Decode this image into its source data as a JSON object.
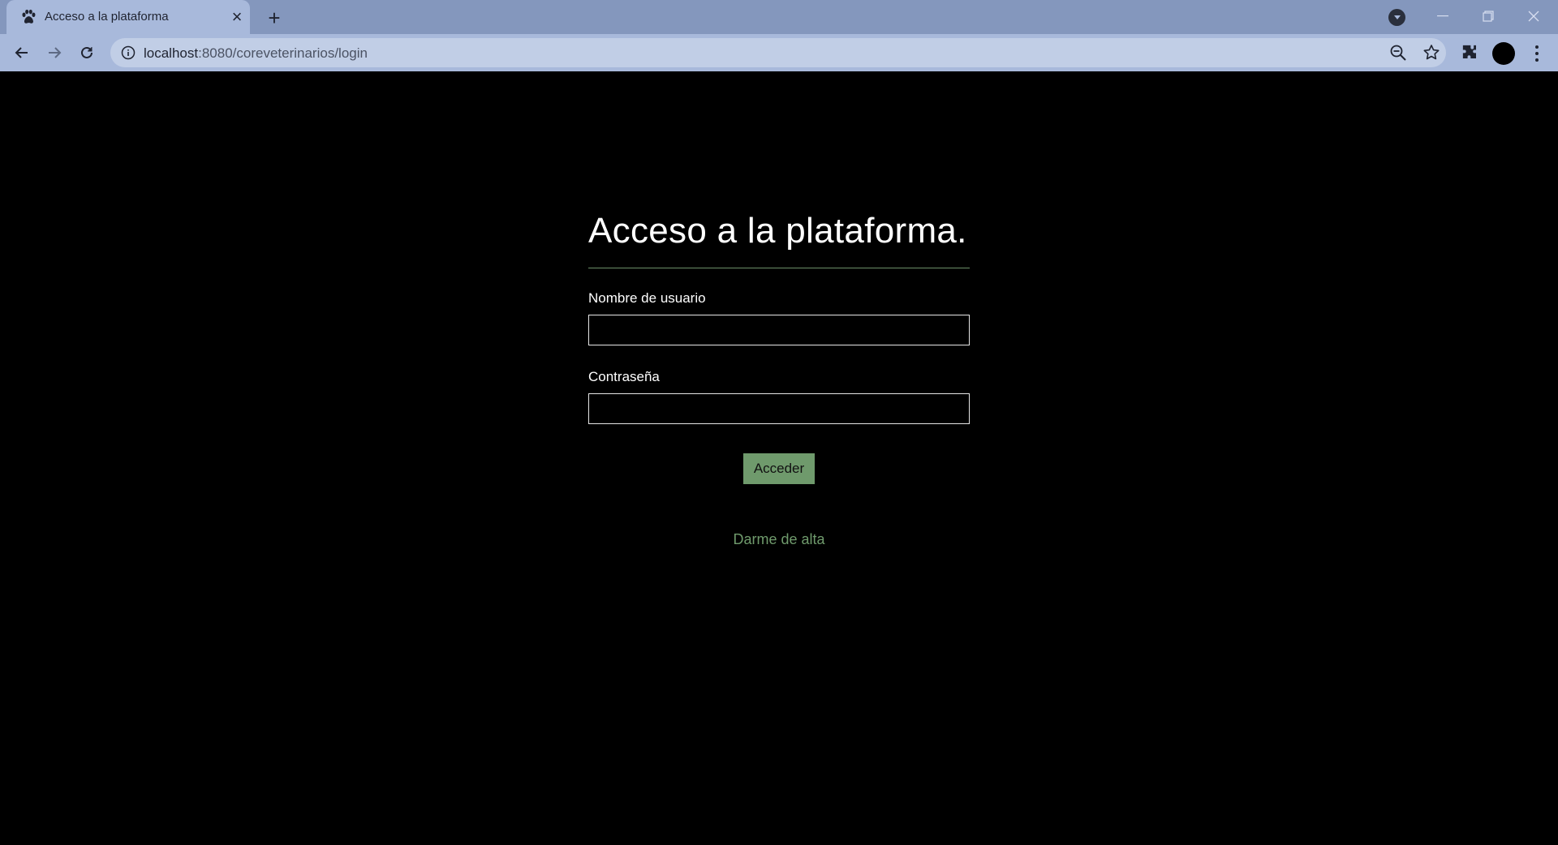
{
  "browser": {
    "tab_title": "Acceso a la plataforma",
    "url_host": "localhost",
    "url_path": ":8080/coreveterinarios/login"
  },
  "login": {
    "heading": "Acceso a la plataforma.",
    "username_label": "Nombre de usuario",
    "username_value": "",
    "password_label": "Contraseña",
    "password_value": "",
    "submit_label": "Acceder",
    "signup_link": "Darme de alta"
  },
  "colors": {
    "accent": "#6f9a6c",
    "background": "#000000",
    "browser_frame": "#8497bd",
    "toolbar": "#a8b9db"
  },
  "icons": [
    "paw-icon",
    "close-icon",
    "plus-icon",
    "tab-search-icon",
    "back-icon",
    "forward-icon",
    "reload-icon",
    "info-icon",
    "zoom-out-icon",
    "star-icon",
    "extensions-icon",
    "profile-avatar",
    "menu-icon"
  ]
}
